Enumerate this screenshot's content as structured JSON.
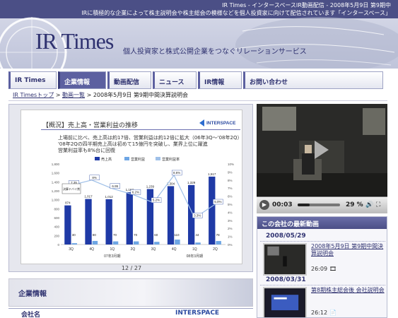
{
  "header": {
    "top_line1": "IR Times - インタースペースIR動画配信 - 2008年5月9日 第9期中",
    "top_line2": "IRに積極的な企業によって株主説明会や株主総会の模様などを個人投資家に向けて配信されています「インタースペース」",
    "logo_text": "IR Times",
    "tagline": "個人投資家と株式公開企業をつなぐリレーションサービス"
  },
  "nav": {
    "tabs": [
      {
        "label": "IR Times",
        "active": false
      },
      {
        "label": "企業情報",
        "active": true
      },
      {
        "label": "動画配信",
        "active": false
      },
      {
        "label": "ニュース",
        "active": false
      },
      {
        "label": "IR情報",
        "active": false
      },
      {
        "label": "お問い合わせ",
        "active": false
      }
    ]
  },
  "breadcrumb": {
    "home": "IR Timesトップ",
    "sep": ">",
    "list": "動画一覧",
    "current": "2008年5月9日 第9期中間決算説明会"
  },
  "slide": {
    "title": "【概況】売上高・営業利益の推移",
    "brand": "INTERSPACE",
    "text_lines": [
      "上場前に比べ、売上高は約17倍、営業利益は約12倍に拡大（06年3Q～'08年2Q）",
      "'08年2Qの四半期売上高は初めて15億円を突破し、業界上位に躍進",
      "営業利益率も8%台に回復"
    ],
    "pager": "12 / 27"
  },
  "chart_data": {
    "type": "bar",
    "categories": [
      "3Q",
      "4Q",
      "1Q",
      "2Q",
      "3Q",
      "4Q",
      "1Q",
      "2Q"
    ],
    "legend": [
      "売上高",
      "営業利益",
      "営業利益率"
    ],
    "series": [
      {
        "name": "売上高",
        "values": [
          874,
          1017,
          1012,
          1167,
          1239,
          1304,
          1329,
          1517
        ]
      },
      {
        "name": "営業利益",
        "values": [
          30,
          80,
          70,
          70,
          60,
          110,
          44,
          78
        ]
      },
      {
        "name": "営業利益率",
        "values": [
          7.35,
          8.0,
          6.95,
          6.2,
          5.2,
          8.6,
          3.3,
          5.0
        ]
      }
    ],
    "bar_labels": [
      "874",
      "1,017",
      "1,012",
      "1,167",
      "1,239",
      "1,304",
      "1,329",
      "1,517"
    ],
    "line_labels": [
      "7.35",
      "8%",
      "6.95",
      "6.2%",
      "5.2%",
      "8.6%",
      "3.3%",
      "5.0%"
    ],
    "period_labels": [
      "07年3月期",
      "08年3月期"
    ],
    "callout": "決算ドバイ賞",
    "y_left_ticks": [
      "0",
      "200",
      "400",
      "600",
      "800",
      "1,000",
      "1,200",
      "1,400",
      "1,600",
      "1,800"
    ],
    "y_right_ticks": [
      "0%",
      "1%",
      "2%",
      "3%",
      "4%",
      "5%",
      "6%",
      "7%",
      "8%",
      "9%",
      "10%"
    ],
    "ylim": [
      0,
      1800
    ],
    "y2lim": [
      0,
      10
    ],
    "colors": {
      "sales": "#1f3aa6",
      "profit": "#6ea6e4",
      "margin": "#9fc0e8"
    }
  },
  "video": {
    "time": "00:03",
    "percent": "29 %",
    "progress": 0.29
  },
  "latest": {
    "heading": "この会社の最新動画",
    "entries": [
      {
        "date": "2008/05/29",
        "title": "2008年5月9日 第9期中間決算説明会",
        "duration": "26:09"
      },
      {
        "date": "2008/03/31",
        "title": "第8期株主総会後 会社説明会",
        "duration": "26:12"
      }
    ]
  },
  "company": {
    "heading": "企業情報",
    "sub": "会社名",
    "logo": "INTERSPACE"
  }
}
